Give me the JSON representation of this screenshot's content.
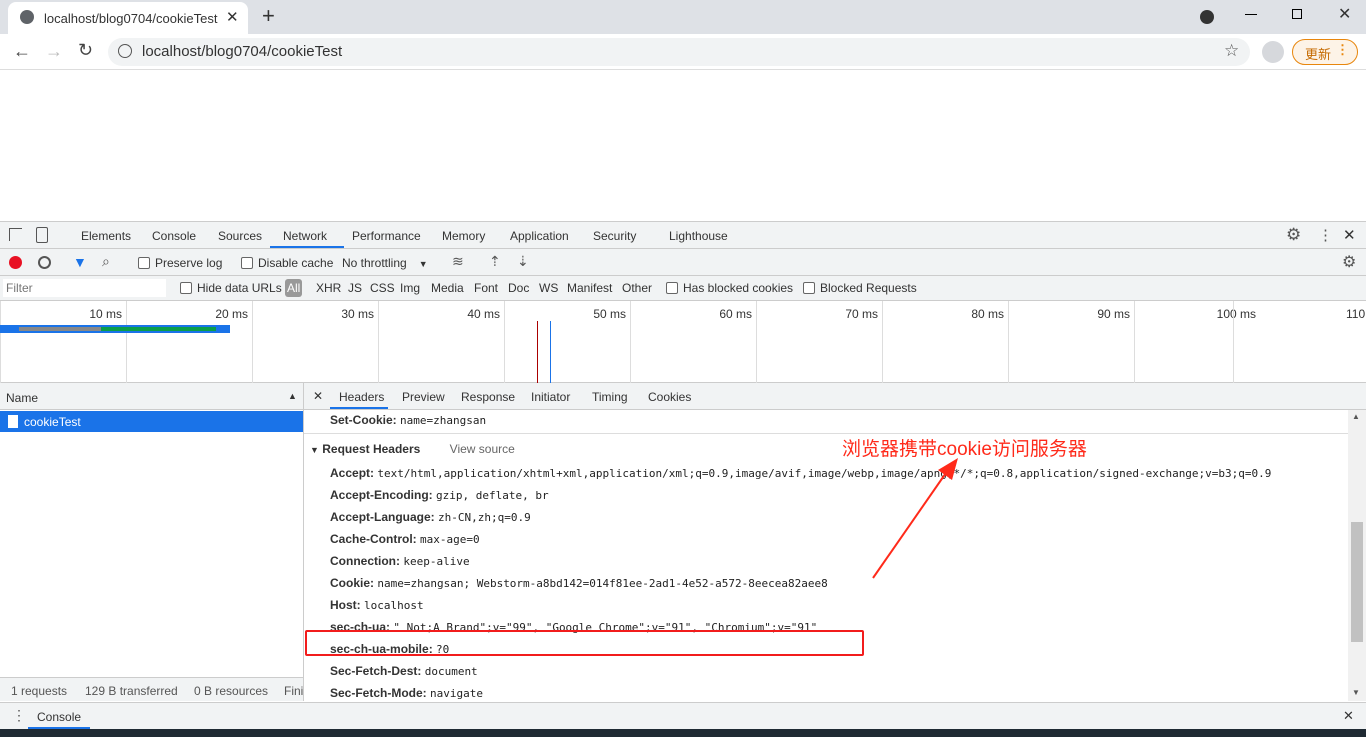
{
  "browser": {
    "tab_title": "localhost/blog0704/cookieTest",
    "url": "localhost/blog0704/cookieTest",
    "update_label": "更新"
  },
  "devtools": {
    "tabs": [
      "Elements",
      "Console",
      "Sources",
      "Network",
      "Performance",
      "Memory",
      "Application",
      "Security",
      "Lighthouse"
    ],
    "active_tab": "Network",
    "toolbar": {
      "preserve_log": "Preserve log",
      "disable_cache": "Disable cache",
      "throttling": "No throttling"
    },
    "filter": {
      "placeholder": "Filter",
      "hide_data_urls": "Hide data URLs",
      "types": [
        "All",
        "XHR",
        "JS",
        "CSS",
        "Img",
        "Media",
        "Font",
        "Doc",
        "WS",
        "Manifest",
        "Other"
      ],
      "has_blocked_cookies": "Has blocked cookies",
      "blocked_requests": "Blocked Requests"
    },
    "timeline": {
      "ticks": [
        "10 ms",
        "20 ms",
        "30 ms",
        "40 ms",
        "50 ms",
        "60 ms",
        "70 ms",
        "80 ms",
        "90 ms",
        "100 ms",
        "110"
      ]
    },
    "requests": {
      "column": "Name",
      "items": [
        "cookieTest"
      ]
    },
    "status": {
      "requests": "1 requests",
      "transferred": "129 B transferred",
      "resources": "0 B resources",
      "finish": "Fini"
    },
    "detail_tabs": [
      "Headers",
      "Preview",
      "Response",
      "Initiator",
      "Timing",
      "Cookies"
    ],
    "set_cookie": {
      "key": "Set-Cookie:",
      "value": "name=zhangsan"
    },
    "request_headers": {
      "title": "Request Headers",
      "view_source": "View source",
      "items": [
        {
          "key": "Accept:",
          "value": "text/html,application/xhtml+xml,application/xml;q=0.9,image/avif,image/webp,image/apng,*/*;q=0.8,application/signed-exchange;v=b3;q=0.9"
        },
        {
          "key": "Accept-Encoding:",
          "value": "gzip, deflate, br"
        },
        {
          "key": "Accept-Language:",
          "value": "zh-CN,zh;q=0.9"
        },
        {
          "key": "Cache-Control:",
          "value": "max-age=0"
        },
        {
          "key": "Connection:",
          "value": "keep-alive"
        },
        {
          "key": "Cookie:",
          "value": "name=zhangsan; Webstorm-a8bd142=014f81ee-2ad1-4e52-a572-8eecea82aee8"
        },
        {
          "key": "Host:",
          "value": "localhost"
        },
        {
          "key": "sec-ch-ua:",
          "value": "\" Not;A Brand\";v=\"99\", \"Google Chrome\";v=\"91\", \"Chromium\";v=\"91\""
        },
        {
          "key": "sec-ch-ua-mobile:",
          "value": "?0"
        },
        {
          "key": "Sec-Fetch-Dest:",
          "value": "document"
        },
        {
          "key": "Sec-Fetch-Mode:",
          "value": "navigate"
        }
      ]
    },
    "drawer": {
      "console": "Console"
    }
  },
  "annotation": {
    "text": "浏览器携带cookie访问服务器",
    "color": "#ff2a1a"
  }
}
